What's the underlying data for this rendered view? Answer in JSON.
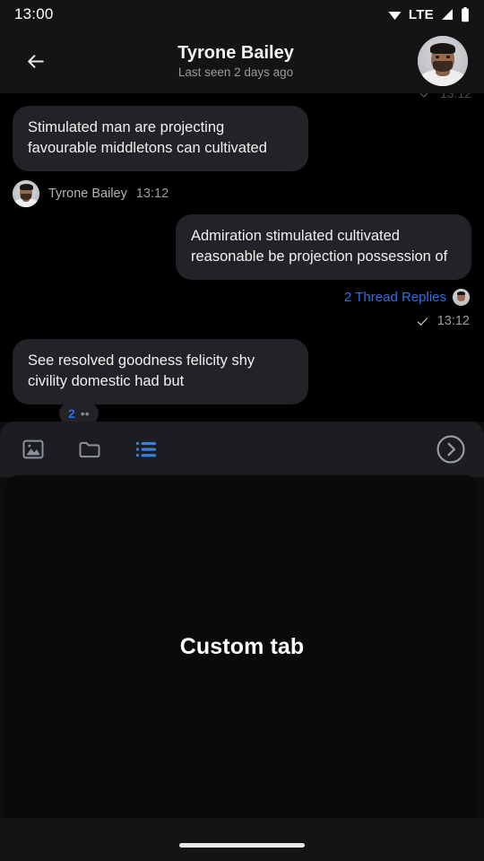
{
  "status_bar": {
    "time": "13:00",
    "network": "LTE",
    "icons": [
      "wifi-icon",
      "signal-icon",
      "battery-icon"
    ]
  },
  "header": {
    "back_icon": "arrow-left-icon",
    "title": "Tyrone Bailey",
    "subtitle": "Last seen 2 days ago",
    "avatar": "contact-avatar"
  },
  "chat": {
    "clipped_top": {
      "check_icon": "check-icon",
      "time": "13:12"
    },
    "messages": [
      {
        "id": "msg-1",
        "direction": "incoming",
        "text": "Stimulated man are projecting favourable middletons can cultivated"
      },
      {
        "id": "msg-2",
        "direction": "outgoing",
        "text": "Admiration stimulated cultivated reasonable be projection possession of"
      },
      {
        "id": "msg-3",
        "direction": "incoming",
        "text": "See resolved goodness felicity shy civility domestic had but"
      }
    ],
    "sender_meta": {
      "name": "Tyrone Bailey",
      "time": "13:12"
    },
    "thread": {
      "label": "2 Thread Replies",
      "avatar": "thread-participant-avatar"
    },
    "delivery": {
      "check_icon": "check-icon",
      "time": "13:12"
    },
    "clipped_chip": {
      "count": "2",
      "extra": "••"
    }
  },
  "toolbar": {
    "items": [
      {
        "id": "gallery",
        "icon": "image-icon",
        "active": false
      },
      {
        "id": "files",
        "icon": "folder-icon",
        "active": false
      },
      {
        "id": "custom",
        "icon": "list-icon",
        "active": true
      }
    ],
    "send": {
      "icon": "chevron-right-circle-icon"
    }
  },
  "tab_content": {
    "label": "Custom tab"
  },
  "nav": {
    "home_indicator": "home-indicator"
  },
  "colors": {
    "background": "#0d0d0d",
    "chat_background": "#000000",
    "bubble": "#212326",
    "panel": "#1b1d21",
    "accent_blue": "#2e6fe0",
    "text_primary": "#f0f0f0",
    "text_secondary": "#9d9d9d"
  }
}
